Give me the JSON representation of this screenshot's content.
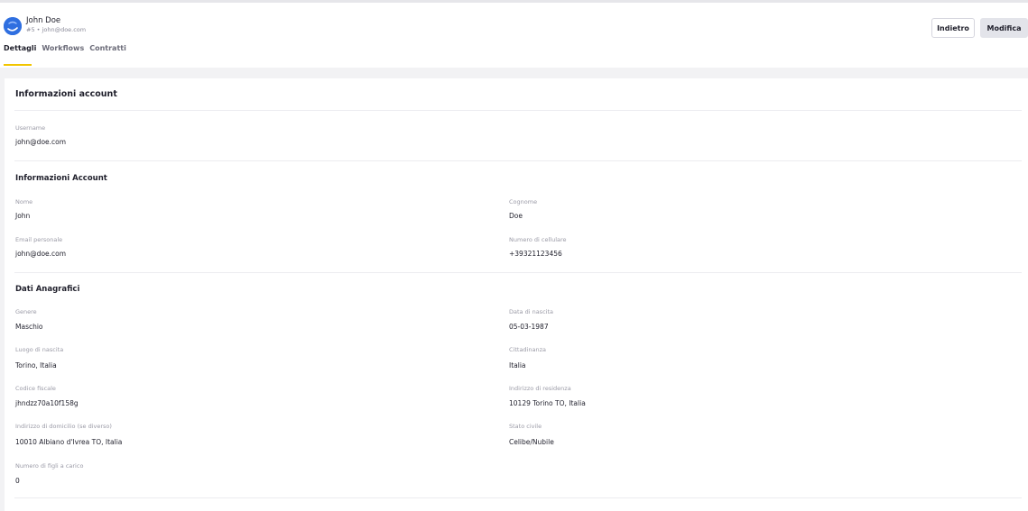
{
  "user": {
    "name": "John Doe",
    "subtitle": "#5 • john@doe.com"
  },
  "tabs": [
    "Dettagli",
    "Workflows",
    "Contratti"
  ],
  "buttons": {
    "back": "Indietro",
    "edit": "Modifica"
  },
  "card_title": "Informazioni account",
  "account": {
    "username_label": "Username",
    "username_value": "john@doe.com"
  },
  "info_account": {
    "title": "Informazioni Account",
    "nome_label": "Nome",
    "nome_value": "John",
    "cognome_label": "Cognome",
    "cognome_value": "Doe",
    "email_label": "Email personale",
    "email_value": "john@doe.com",
    "cell_label": "Numero di cellulare",
    "cell_value": "+39321123456"
  },
  "anagrafici": {
    "title": "Dati Anagrafici",
    "genere_label": "Genere",
    "genere_value": "Maschio",
    "nascita_label": "Data di nascita",
    "nascita_value": "05-03-1987",
    "luogo_label": "Luogo di nascita",
    "luogo_value": "Torino, Italia",
    "cittadinanza_label": "Cittadinanza",
    "cittadinanza_value": "Italia",
    "cf_label": "Codice fiscale",
    "cf_value": "jhndzz70a10f158g",
    "residenza_label": "Indirizzo di residenza",
    "residenza_value": "10129 Torino TO, Italia",
    "domicilio_label": "Indirizzo di domicilio (se diverso)",
    "domicilio_value": "10010 Albiano d'Ivrea TO, Italia",
    "civile_label": "Stato civile",
    "civile_value": "Celibe/Nubile",
    "figli_label": "Numero di figli a carico",
    "figli_value": "0"
  },
  "colors": {
    "accent": "#f2c500",
    "avatar": "#2f6fe0"
  }
}
